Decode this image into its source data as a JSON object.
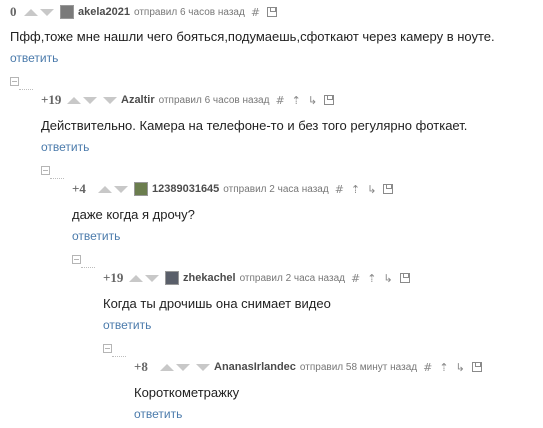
{
  "comments": [
    {
      "rating": "0",
      "author": "akela2021",
      "meta": "отправил 6 часов назад",
      "text": "Пфф,тоже мне нашли чего бояться,подумаешь,сфоткают через камеру в ноуте.",
      "reply": "ответить",
      "avatar_color": "#7a7a7a"
    },
    {
      "rating": "+19",
      "author": "Azaltir",
      "meta": "отправил 6 часов назад",
      "text": "Действительно. Камера на телефоне-то и без того регулярно фоткает.",
      "reply": "ответить",
      "avatar_color": ""
    },
    {
      "rating": "+4",
      "author": "12389031645",
      "meta": "отправил 2 часа назад",
      "text": "даже когда я дрочу?",
      "reply": "ответить",
      "avatar_color": "#6b7d4e"
    },
    {
      "rating": "+19",
      "author": "zhekachel",
      "meta": "отправил 2 часа назад",
      "text": "Когда ты дрочишь она снимает видео",
      "reply": "ответить",
      "avatar_color": "#5a5f6a"
    },
    {
      "rating": "+8",
      "author": "AnanasIrlandec",
      "meta": "отправил 58 минут назад",
      "text": "Короткометражку",
      "reply": "ответить",
      "avatar_color": ""
    }
  ],
  "icons": {
    "hash": "#",
    "up_arrow": "⇡",
    "parent": "↳",
    "save": "save-icon"
  },
  "colors": {
    "link": "#4a7aab",
    "rating": "#666666",
    "vote_arrow": "#c8c8c8"
  }
}
